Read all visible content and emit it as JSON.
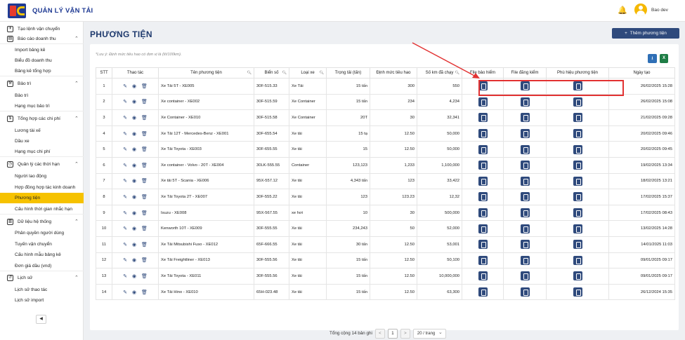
{
  "app": {
    "title": "QUẢN LÝ VẬN TẢI",
    "user": "Bao dev"
  },
  "sidebar": {
    "items": [
      {
        "kind": "group",
        "label": "Tạo lệnh vận chuyển",
        "icon": "✈",
        "chev": ""
      },
      {
        "kind": "group",
        "label": "Báo cáo doanh thu",
        "icon": "▤",
        "chev": "⌃"
      },
      {
        "kind": "sub",
        "label": "Import bảng kê"
      },
      {
        "kind": "sub",
        "label": "Biểu đồ doanh thu"
      },
      {
        "kind": "sub",
        "label": "Bảng kê tổng hợp"
      },
      {
        "kind": "group",
        "label": "Bảo trì",
        "icon": "⚒",
        "chev": "⌃"
      },
      {
        "kind": "sub",
        "label": "Bảo trì"
      },
      {
        "kind": "sub",
        "label": "Hạng mục bảo trì"
      },
      {
        "kind": "group",
        "label": "Tổng hợp các chi phí",
        "icon": "$",
        "chev": "⌃"
      },
      {
        "kind": "sub",
        "label": "Lương tài xế"
      },
      {
        "kind": "sub",
        "label": "Dầu xe"
      },
      {
        "kind": "sub",
        "label": "Hạng mục chi phí"
      },
      {
        "kind": "group",
        "label": "Quản lý các thời hạn",
        "icon": "◷",
        "chev": "⌃"
      },
      {
        "kind": "sub",
        "label": "Người lao động"
      },
      {
        "kind": "sub",
        "label": "Hợp đồng hợp tác kinh doanh"
      },
      {
        "kind": "sub",
        "label": "Phương tiện",
        "active": true
      },
      {
        "kind": "sub",
        "label": "Cấu hình thời gian nhắc hạn"
      },
      {
        "kind": "group",
        "label": "Dữ liệu hệ thống",
        "icon": "▥",
        "chev": "⌃"
      },
      {
        "kind": "sub",
        "label": "Phân quyền người dùng"
      },
      {
        "kind": "sub",
        "label": "Tuyến vận chuyển"
      },
      {
        "kind": "sub",
        "label": "Cấu hình mẫu bảng kê"
      },
      {
        "kind": "sub",
        "label": "Đơn giá dầu (vnd)"
      },
      {
        "kind": "group",
        "label": "Lịch sử",
        "icon": "↺",
        "chev": "⌃"
      },
      {
        "kind": "sub",
        "label": "Lịch sử thao tác"
      },
      {
        "kind": "sub",
        "label": "Lịch sử import"
      }
    ],
    "collapse_icon": "◀"
  },
  "page": {
    "title": "PHƯƠNG TIỆN",
    "add_button": "Thêm phương tiện",
    "note": "*Lưu ý: Định mức tiêu hao có đơn vị là (lít/100km).",
    "excel_label": "X"
  },
  "table": {
    "headers": [
      "STT",
      "Thao tác",
      "Tên phương tiện",
      "Biển số",
      "Loại xe",
      "Trọng tải (tấn)",
      "Định mức tiêu hao",
      "Số km đã chạy",
      "File bảo hiểm",
      "File đăng kiểm",
      "Phù hiệu phương tiện",
      "Ngày tạo"
    ],
    "rows": [
      [
        "1",
        "Xe Tải 5T - XE005",
        "30F-515.33",
        "Xe Tải",
        "15 tấn",
        "300",
        "550",
        "26/02/2025 15:28"
      ],
      [
        "2",
        "Xe container - XE002",
        "30F-515.59",
        "Xe Container",
        "15 tấn",
        "234",
        "4,234",
        "26/02/2025 15:08"
      ],
      [
        "3",
        "Xe Container - XE010",
        "30F-515.58",
        "Xe Container",
        "20T",
        "30",
        "32,341",
        "21/02/2025 09:28"
      ],
      [
        "4",
        "Xe Tải 12T - Mercedes-Benz - XE001",
        "30F-655.54",
        "Xe tải",
        "15 tạ",
        "12.50",
        "50,000",
        "20/02/2025 09:46"
      ],
      [
        "5",
        "Xe Tải Toyota - XE003",
        "30F-655.55",
        "Xe tải",
        "15",
        "12.50",
        "50,000",
        "20/02/2025 09:45"
      ],
      [
        "6",
        "Xe container - Volvo - 20T - XE004",
        "30LK-555.55",
        "Container",
        "123,123",
        "1,233",
        "1,100,000",
        "19/02/2025 13:34"
      ],
      [
        "7",
        "Xe tải 5T - Scania - XE006",
        "95X-557.12",
        "Xe tải",
        "4,343 tấn",
        "123",
        "33,422",
        "18/02/2025 13:21"
      ],
      [
        "8",
        "Xe Tải Toyota 2T - XE007",
        "30F-555.22",
        "Xe tải",
        "123",
        "123.23",
        "12,32",
        "17/02/2025 15:37"
      ],
      [
        "9",
        "Isuzu - XE008",
        "95X-567.55",
        "xe hơi",
        "10",
        "30",
        "500,000",
        "17/02/2025 08:43"
      ],
      [
        "10",
        "Kenworth 10T - XE009",
        "30F-555.55",
        "Xe tải",
        "234,243",
        "50",
        "52,000",
        "13/02/2025 14:28"
      ],
      [
        "11",
        "Xe Tải Mitsubishi Fuso - XE012",
        "65F-666.55",
        "Xe tải",
        "30 tấn",
        "12.50",
        "53,001",
        "14/01/2025 11:03"
      ],
      [
        "12",
        "Xe Tải Freightliner - XE013",
        "30F-555.56",
        "Xe tải",
        "15 tấn",
        "12.50",
        "50,100",
        "09/01/2025 09:17"
      ],
      [
        "13",
        "Xe Tải Toyota - XE011",
        "30F-555.56",
        "Xe tải",
        "15 tấn",
        "12.50",
        "10,000,000",
        "09/01/2025 09:17"
      ],
      [
        "14",
        "Xe Tải Hino - XE010",
        "65H-023.48",
        "Xe tải",
        "15 tấn",
        "12.50",
        "63,300",
        "26/12/2024 15:35"
      ]
    ]
  },
  "pagination": {
    "total": "Tổng cộng 14 bản ghi",
    "prev": "<",
    "current": "1",
    "next": ">",
    "page_size": "20 / trang"
  },
  "colors": {
    "accent": "#2f4a7c",
    "active_nav": "#f6c200",
    "highlight": "#e23232"
  }
}
